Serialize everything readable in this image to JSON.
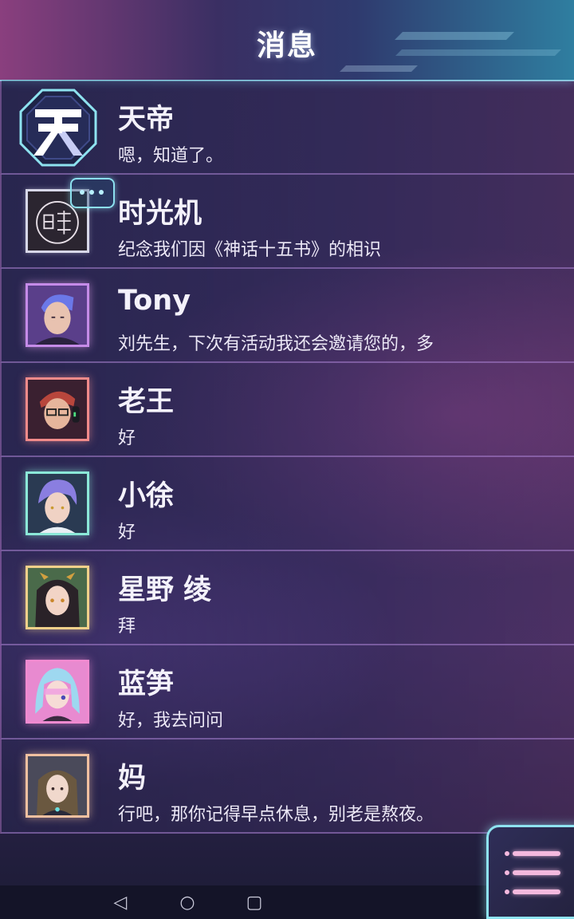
{
  "header": {
    "title": "消息"
  },
  "conversations": [
    {
      "name": "天帝",
      "preview": "嗯，知道了。",
      "frame_color": "#8ee3f0"
    },
    {
      "name": "时光机",
      "preview": "纪念我们因《神话十五书》的相识",
      "frame_color": "#d7d7e8"
    },
    {
      "name": "Tony",
      "preview": "刘先生，下次有活动我还会邀请您的，多",
      "frame_color": "#c58be8"
    },
    {
      "name": "老王",
      "preview": "好",
      "frame_color": "#f08a8a"
    },
    {
      "name": "小徐",
      "preview": "好",
      "frame_color": "#8be8d8"
    },
    {
      "name": "星野 绫",
      "preview": "拜",
      "frame_color": "#f0d08a"
    },
    {
      "name": "蓝笋",
      "preview": "好，我去问问",
      "frame_color": "#f08ad0"
    },
    {
      "name": "妈",
      "preview": "行吧，那你记得早点休息，别老是熬夜。",
      "frame_color": "#f0c0a0"
    }
  ],
  "icons": {
    "bubble": "speech-bubble-icon",
    "menu": "menu-list-icon",
    "nav_back": "◁",
    "nav_home": "○",
    "nav_recent": "▢"
  }
}
